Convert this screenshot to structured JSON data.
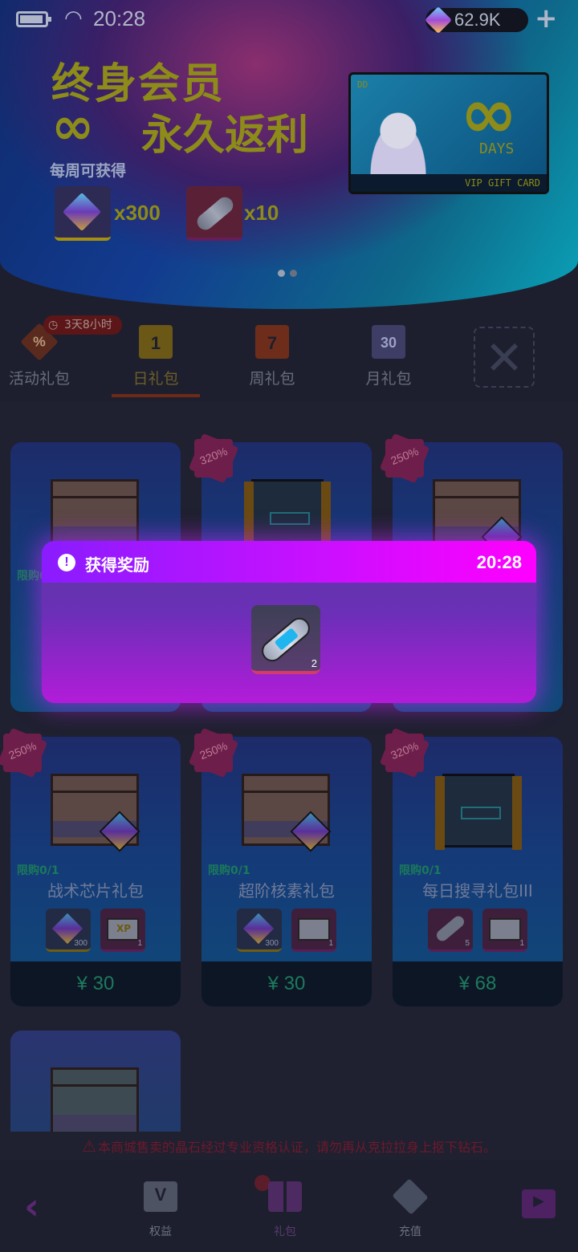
{
  "status_bar": {
    "time": "20:28"
  },
  "currency": {
    "amount": "62.9K",
    "plus": "+"
  },
  "banner": {
    "headline": "终身会员",
    "subline": "永久返利",
    "weekly_label": "每周可获得",
    "rewards": [
      {
        "icon": "gem-icon",
        "qty": "x300"
      },
      {
        "icon": "capsule-icon",
        "qty": "x10"
      }
    ],
    "card": {
      "dd": "DD",
      "days": "DAYS",
      "label": "VIP GIFT CARD"
    },
    "page_dots": 2
  },
  "tabs": {
    "items": [
      {
        "label": "活动礼包",
        "icon": "%"
      },
      {
        "label": "日礼包",
        "icon": "1",
        "active": true
      },
      {
        "label": "周礼包",
        "icon": "7"
      },
      {
        "label": "月礼包",
        "icon": "30"
      }
    ],
    "timer": "3天8小时"
  },
  "products": [
    {
      "name": "",
      "badge": "",
      "price": "",
      "limit": "限购0/1"
    },
    {
      "name": "",
      "badge": "320%",
      "price": "",
      "limit": ""
    },
    {
      "name": "",
      "badge": "250%",
      "price": "",
      "limit": ""
    },
    {
      "name": "战术芯片礼包",
      "badge": "250%",
      "price": "¥ 30",
      "limit": "限购0/1",
      "rewards": [
        {
          "qty": "300"
        },
        {
          "qty": "1",
          "tag": "XP"
        }
      ]
    },
    {
      "name": "超阶核素礼包",
      "badge": "250%",
      "price": "¥ 30",
      "limit": "限购0/1",
      "rewards": [
        {
          "qty": "300"
        },
        {
          "qty": "1",
          "tag": ""
        }
      ]
    },
    {
      "name": "每日搜寻礼包III",
      "badge": "320%",
      "price": "¥ 68",
      "limit": "限购0/1",
      "rewards": [
        {
          "qty": "5"
        },
        {
          "qty": "1",
          "tag": ""
        }
      ]
    },
    {
      "name": "",
      "badge": "",
      "price": "",
      "limit": ""
    }
  ],
  "warning": "本商城售卖的晶石经过专业资格认证，请勿再从克拉拉身上抠下钻石。",
  "nav": {
    "items": [
      {
        "label": "权益"
      },
      {
        "label": "礼包"
      },
      {
        "label": "充值"
      }
    ]
  },
  "popup": {
    "title": "获得奖励",
    "time": "20:28",
    "item_qty": "2"
  },
  "colors": {
    "popup_header_start": "#8a1cff",
    "popup_header_end": "#ff00ff",
    "price_green": "#1d7a5e",
    "badge_pink": "#6e1e4a"
  }
}
